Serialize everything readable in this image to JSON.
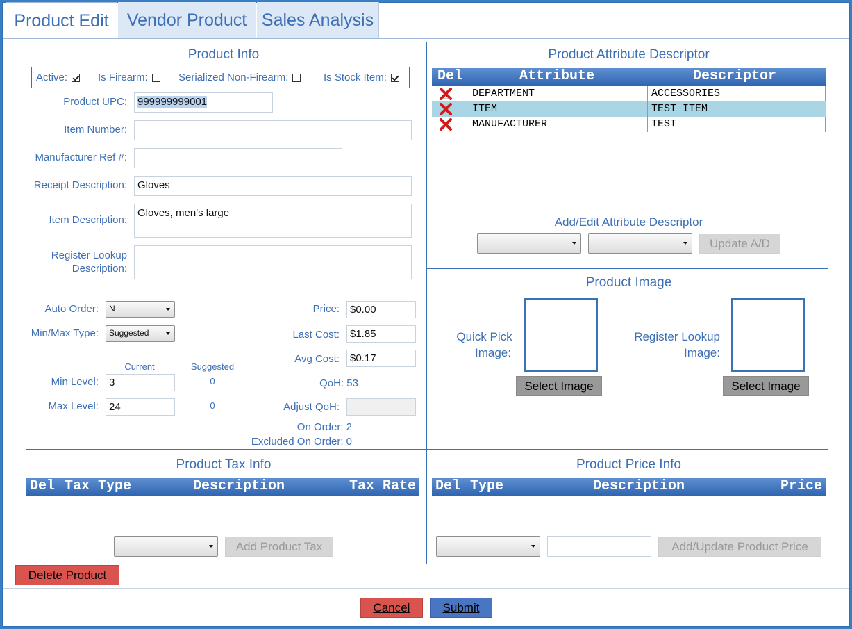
{
  "tabs": [
    {
      "label": "Product Edit",
      "active": true
    },
    {
      "label": "Vendor Product",
      "active": false
    },
    {
      "label": "Sales Analysis",
      "active": false
    }
  ],
  "product_info": {
    "title": "Product Info",
    "flags": {
      "active_label": "Active:",
      "active": true,
      "firearm_label": "Is Firearm:",
      "firearm": false,
      "serialized_label": "Serialized Non-Firearm:",
      "serialized": false,
      "stock_label": "Is Stock Item:",
      "stock": true
    },
    "upc_label": "Product UPC:",
    "upc": "999999999001",
    "item_number_label": "Item Number:",
    "item_number": "",
    "mfr_ref_label": "Manufacturer Ref #:",
    "mfr_ref": "",
    "receipt_desc_label": "Receipt Description:",
    "receipt_desc": "Gloves",
    "item_desc_label": "Item Description:",
    "item_desc": "Gloves, men's large",
    "register_lookup_label_1": "Register Lookup",
    "register_lookup_label_2": "Description:",
    "register_lookup": "",
    "auto_order_label": "Auto Order:",
    "auto_order": "N",
    "minmax_type_label": "Min/Max Type:",
    "minmax_type": "Suggested",
    "current_label": "Current",
    "suggested_label": "Suggested",
    "min_level_label": "Min Level:",
    "min_level": "3",
    "min_suggested": "0",
    "max_level_label": "Max Level:",
    "max_level": "24",
    "max_suggested": "0",
    "price_label": "Price:",
    "price": "$0.00",
    "last_cost_label": "Last Cost:",
    "last_cost": "$1.85",
    "avg_cost_label": "Avg Cost:",
    "avg_cost": "$0.17",
    "qoh_text": "QoH: 53",
    "adjust_qoh_label": "Adjust QoH:",
    "adjust_qoh": "",
    "on_order_text": "On Order: 2",
    "excluded_text": "Excluded On Order: 0"
  },
  "attributes": {
    "title": "Product Attribute Descriptor",
    "headers": {
      "del": "Del",
      "attribute": "Attribute",
      "descriptor": "Descriptor"
    },
    "rows": [
      {
        "attribute": "DEPARTMENT",
        "descriptor": "ACCESSORIES",
        "selected": false
      },
      {
        "attribute": "ITEM",
        "descriptor": "TEST ITEM",
        "selected": true
      },
      {
        "attribute": "MANUFACTURER",
        "descriptor": "TEST",
        "selected": false
      }
    ],
    "add_edit_title": "Add/Edit Attribute Descriptor",
    "attr_select": "",
    "desc_select": "",
    "update_button": "Update A/D"
  },
  "image": {
    "title": "Product Image",
    "quick_pick_1": "Quick Pick",
    "quick_pick_2": "Image:",
    "register_1": "Register Lookup",
    "register_2": "Image:",
    "select_button": "Select Image"
  },
  "tax": {
    "title": "Product Tax Info",
    "headers": {
      "del": "Del",
      "type": "Tax Type",
      "description": "Description",
      "rate": "Tax Rate"
    },
    "add_button": "Add Product Tax"
  },
  "price_info": {
    "title": "Product Price Info",
    "headers": {
      "del": "Del",
      "type": "Type",
      "description": "Description",
      "price": "Price"
    },
    "price_value": "",
    "add_button": "Add/Update Product Price"
  },
  "actions": {
    "delete": "Delete Product",
    "cancel": "Cancel",
    "submit": "Submit"
  },
  "colors": {
    "accent": "#3d6fb5",
    "header_bar": "#2f64b0",
    "danger": "#d9534f",
    "primary": "#4a75c2",
    "selected_row": "#a9d5e4"
  }
}
